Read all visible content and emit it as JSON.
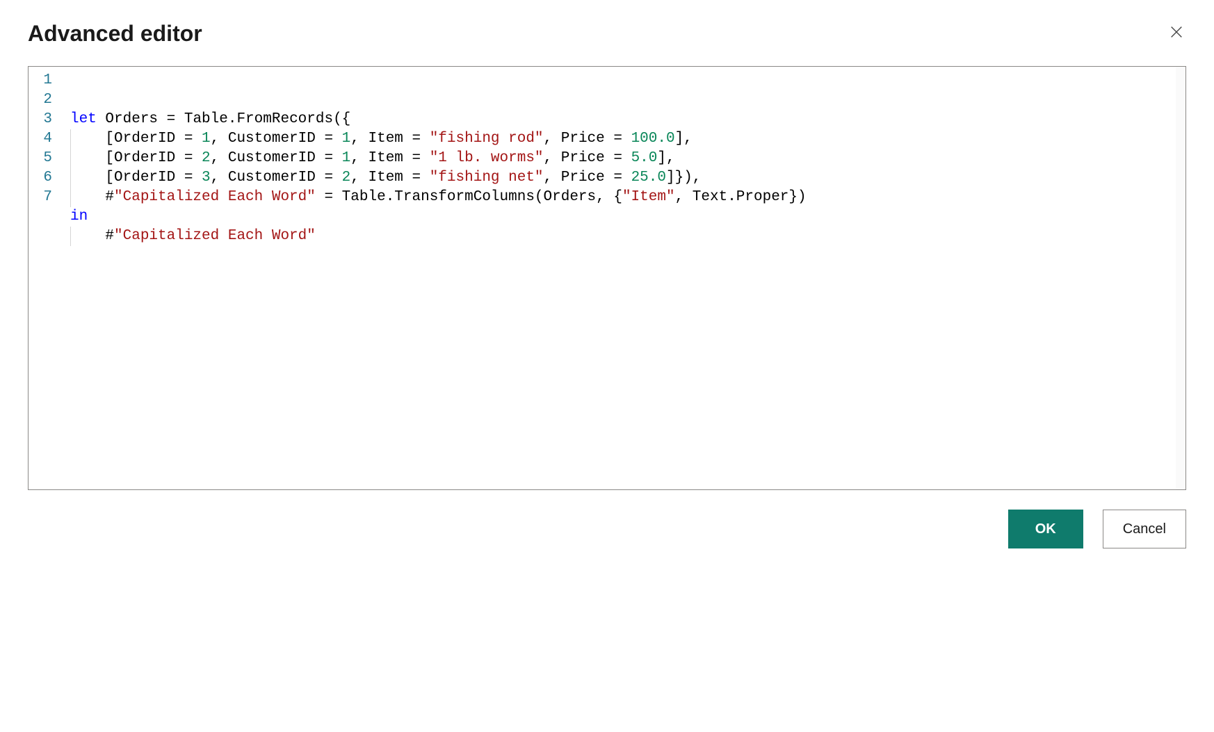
{
  "header": {
    "title": "Advanced editor",
    "close_icon": "close"
  },
  "editor": {
    "line_numbers": [
      "1",
      "2",
      "3",
      "4",
      "5",
      "6",
      "7"
    ],
    "code_tokens": [
      [
        {
          "text": "let ",
          "cls": "kw"
        },
        {
          "text": "Orders = Table.FromRecords({",
          "cls": "plain"
        }
      ],
      [
        {
          "text": "    [OrderID = ",
          "cls": "plain"
        },
        {
          "text": "1",
          "cls": "num"
        },
        {
          "text": ", CustomerID = ",
          "cls": "plain"
        },
        {
          "text": "1",
          "cls": "num"
        },
        {
          "text": ", Item = ",
          "cls": "plain"
        },
        {
          "text": "\"fishing rod\"",
          "cls": "str"
        },
        {
          "text": ", Price = ",
          "cls": "plain"
        },
        {
          "text": "100.0",
          "cls": "num"
        },
        {
          "text": "],",
          "cls": "plain"
        }
      ],
      [
        {
          "text": "    [OrderID = ",
          "cls": "plain"
        },
        {
          "text": "2",
          "cls": "num"
        },
        {
          "text": ", CustomerID = ",
          "cls": "plain"
        },
        {
          "text": "1",
          "cls": "num"
        },
        {
          "text": ", Item = ",
          "cls": "plain"
        },
        {
          "text": "\"1 lb. worms\"",
          "cls": "str"
        },
        {
          "text": ", Price = ",
          "cls": "plain"
        },
        {
          "text": "5.0",
          "cls": "num"
        },
        {
          "text": "],",
          "cls": "plain"
        }
      ],
      [
        {
          "text": "    [OrderID = ",
          "cls": "plain"
        },
        {
          "text": "3",
          "cls": "num"
        },
        {
          "text": ", CustomerID = ",
          "cls": "plain"
        },
        {
          "text": "2",
          "cls": "num"
        },
        {
          "text": ", Item = ",
          "cls": "plain"
        },
        {
          "text": "\"fishing net\"",
          "cls": "str"
        },
        {
          "text": ", Price = ",
          "cls": "plain"
        },
        {
          "text": "25.0",
          "cls": "num"
        },
        {
          "text": "]}),",
          "cls": "plain"
        }
      ],
      [
        {
          "text": "    #",
          "cls": "plain"
        },
        {
          "text": "\"Capitalized Each Word\"",
          "cls": "str"
        },
        {
          "text": " = Table.TransformColumns(Orders, {",
          "cls": "plain"
        },
        {
          "text": "\"Item\"",
          "cls": "str"
        },
        {
          "text": ", Text.Proper})",
          "cls": "plain"
        }
      ],
      [
        {
          "text": "in",
          "cls": "kw"
        }
      ],
      [
        {
          "text": "    #",
          "cls": "plain"
        },
        {
          "text": "\"Capitalized Each Word\"",
          "cls": "str"
        }
      ]
    ]
  },
  "footer": {
    "ok_label": "OK",
    "cancel_label": "Cancel"
  }
}
